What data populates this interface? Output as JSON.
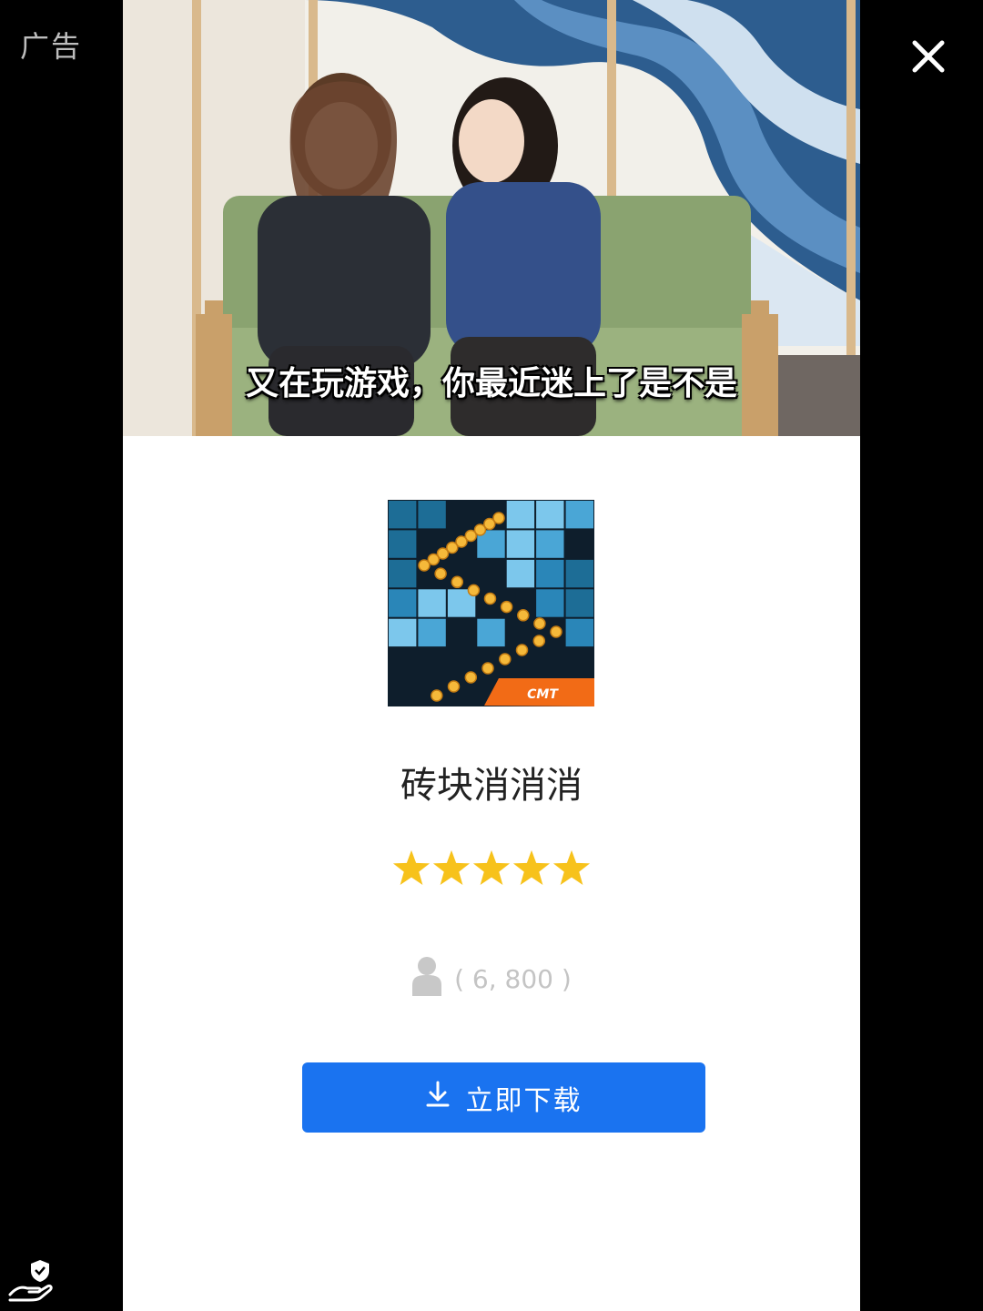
{
  "ad_label": "广告",
  "icons": {
    "close": "close-icon",
    "privacy": "privacy-shield-hand-icon",
    "person": "person-icon",
    "download": "download-arrow-icon",
    "star": "star-icon"
  },
  "video": {
    "subtitle": "又在玩游戏，你最近迷上了是不是"
  },
  "app": {
    "icon_badge": "CMT",
    "name": "砖块消消消",
    "rating_stars": 5,
    "rating_max": 5,
    "downloads_text": "( 6, 800 )"
  },
  "cta": {
    "label": "立即下载"
  },
  "colors": {
    "button": "#1a73f0",
    "star": "#f7c21b",
    "icon_bg": "#0e1e2c",
    "icon_badge": "#f26b16"
  }
}
